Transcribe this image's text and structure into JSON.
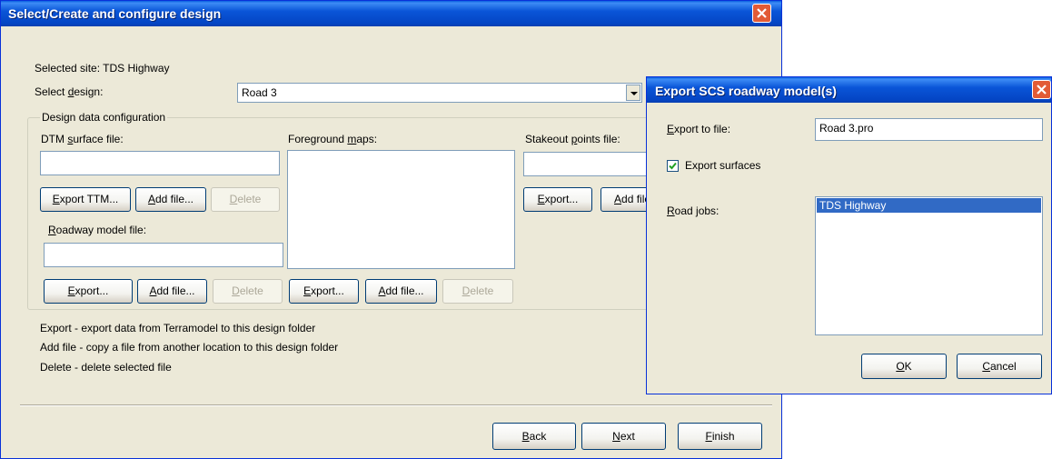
{
  "main": {
    "title": "Select/Create and configure design",
    "selected_site": "Selected site: TDS Highway",
    "select_design_label": "Select design:",
    "design_value": "Road 3",
    "group_label": "Design data configuration",
    "dtm_label": "DTM surface file:",
    "export_ttm": "Export TTM...",
    "add_file": "Add file...",
    "delete": "Delete",
    "roadway_label": "Roadway model file:",
    "export": "Export...",
    "foreground_label": "Foreground maps:",
    "stakeout_label": "Stakeout points file:",
    "stakeout_add_file": "Add file",
    "help1": "Export - export data from Terramodel to this design folder",
    "help2": "Add file - copy a file from another location to this design folder",
    "help3": "Delete - delete selected file",
    "back": "Back",
    "next": "Next",
    "finish": "Finish"
  },
  "export_dialog": {
    "title": "Export SCS roadway model(s)",
    "export_to_file_label": "Export to file:",
    "file_value": "Road 3.pro",
    "export_surfaces_label": "Export surfaces",
    "export_surfaces_checked": true,
    "road_jobs_label": "Road jobs:",
    "road_jobs": [
      "TDS Highway"
    ],
    "ok": "OK",
    "cancel": "Cancel"
  }
}
